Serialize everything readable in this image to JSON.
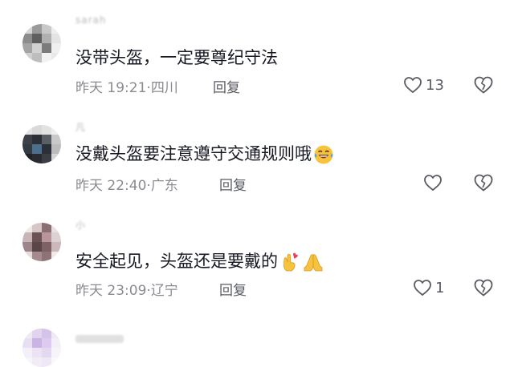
{
  "comments": [
    {
      "user": "sarah",
      "text": "没带头盔，一定要尊纪守法",
      "date": "昨天 19:21",
      "location": "四川",
      "reply_label": "回复",
      "likes": "13",
      "avatar_colors": [
        "#d6d6d6",
        "#9a9a9a",
        "#c8c8c8",
        "#eeeeee",
        "#8c8c8c",
        "#5f5f5f",
        "#b0b0b0",
        "#e4e4e4",
        "#a4a4a4",
        "#d2d2d2",
        "#7b7b7b",
        "#efefef",
        "#cfcfcf",
        "#bdbdbd",
        "#f2f2f2",
        "#e8e8e8"
      ]
    },
    {
      "user": "凡",
      "text": "没戴头盔要注意遵守交通规则哦",
      "emojis": [
        "laughing-tears-emoji"
      ],
      "date": "昨天 22:40",
      "location": "广东",
      "reply_label": "回复",
      "likes": "",
      "avatar_colors": [
        "#e5e5e5",
        "#d9d9d9",
        "#e2e2e2",
        "#eeeeee",
        "#3c4049",
        "#2d2f36",
        "#5a5f66",
        "#c9c9c9",
        "#343a44",
        "#4c6f8c",
        "#2b3038",
        "#bcbcbc",
        "#1f2126",
        "#292b31",
        "#3a3d44",
        "#d6d6d6"
      ]
    },
    {
      "user": "小",
      "text": "安全起见，头盔还是要戴的",
      "emojis": [
        "heart-fingers-emoji",
        "praying-hands-emoji"
      ],
      "date": "昨天 23:09",
      "location": "辽宁",
      "reply_label": "回复",
      "likes": "1",
      "avatar_colors": [
        "#efe9ea",
        "#d7c6c8",
        "#8a6f72",
        "#e7dfe0",
        "#c9b4b7",
        "#6b5255",
        "#b89599",
        "#ddd2d3",
        "#9f8589",
        "#5c4548",
        "#7d6164",
        "#cab8ba",
        "#e6dcdd",
        "#a68b8e",
        "#8f7275",
        "#f0eaea"
      ]
    },
    {
      "user": "",
      "avatar_colors": [
        "#efeaf5",
        "#e0d4ee",
        "#d5c4ea",
        "#efe9f6",
        "#e9dff3",
        "#c9b4e3",
        "#dccbee",
        "#f3eef8",
        "#f4f0f9",
        "#ebe3f4",
        "#e4d8f1",
        "#f6f3fa",
        "#f7f5fb",
        "#f1ecf7",
        "#eee8f6",
        "#faf8fc"
      ]
    }
  ],
  "colors": {
    "text": "#161823",
    "meta": "#8a8b91",
    "icon": "#5a5b63",
    "emoji_yellow": "#f7c33f"
  }
}
